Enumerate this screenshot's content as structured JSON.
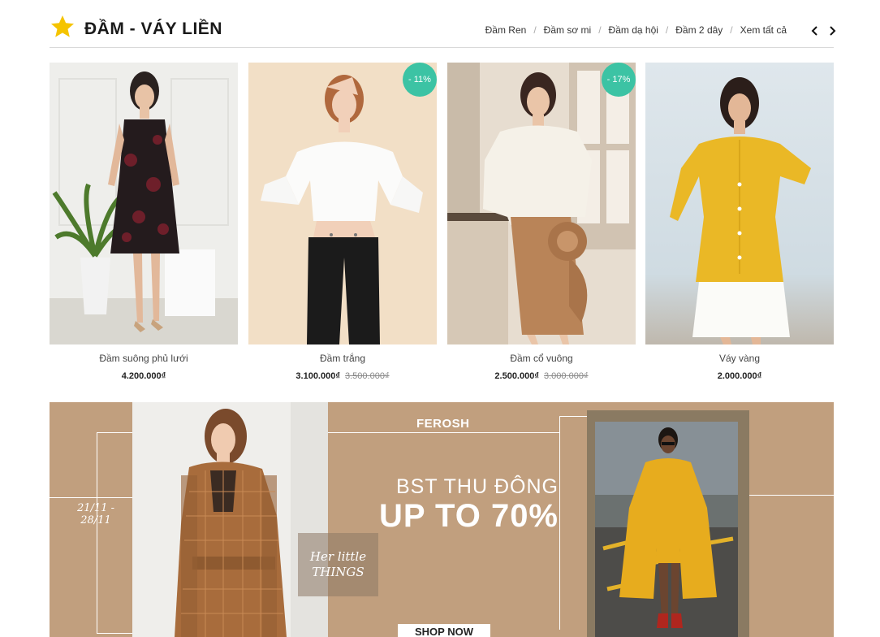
{
  "section": {
    "title": "ĐẦM - VÁY LIỀN",
    "categories": [
      "Đầm Ren",
      "Đầm sơ mi",
      "Đầm dạ hội",
      "Đầm 2 dây",
      "Xem tất cả"
    ],
    "separator": "/",
    "icons": {
      "star": "star-icon",
      "prev": "chevron-left-icon",
      "next": "chevron-right-icon"
    }
  },
  "products": [
    {
      "name": "Đầm suông phủ lưới",
      "price": "4.200.000₫",
      "old_price": "",
      "badge": ""
    },
    {
      "name": "Đầm trắng",
      "price": "3.100.000₫",
      "old_price": "3.500.000₫",
      "badge": "- 11%"
    },
    {
      "name": "Đầm cổ vuông",
      "price": "2.500.000₫",
      "old_price": "3.000.000₫",
      "badge": "- 17%"
    },
    {
      "name": "Váy vàng",
      "price": "2.000.000₫",
      "old_price": "",
      "badge": ""
    }
  ],
  "banner": {
    "brand": "FEROSH",
    "dates_line1": "21/11 -",
    "dates_line2": "28/11",
    "subtitle": "BST THU ĐÔNG",
    "headline": "UP TO 70%",
    "tag_line1": "Her little",
    "tag_line2": "THINGS",
    "cta": "SHOP NOW"
  },
  "colors": {
    "accent": "#3cc3a4",
    "banner_bg": "#c19f7e",
    "star": "#f5c400"
  }
}
